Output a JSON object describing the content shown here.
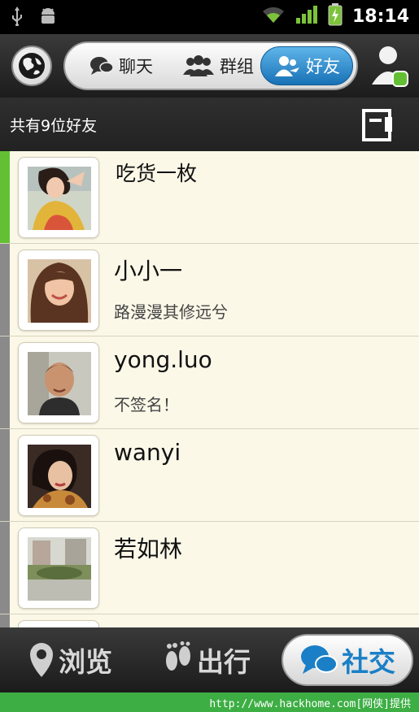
{
  "status_bar": {
    "time": "18:14",
    "icons": [
      "usb-icon",
      "android-debug-icon",
      "wifi-icon",
      "signal-icon",
      "battery-charging-icon"
    ]
  },
  "top_bar": {
    "tabs": [
      {
        "label": "聊天",
        "icon": "chat-icon",
        "selected": false
      },
      {
        "label": "群组",
        "icon": "group-icon",
        "selected": false
      },
      {
        "label": "好友",
        "icon": "friends-icon",
        "selected": true
      }
    ]
  },
  "friends": {
    "count_text": "共有9位好友",
    "items": [
      {
        "name": "吃货一枚",
        "signature": ""
      },
      {
        "name": "小小一",
        "signature": "路漫漫其修远兮"
      },
      {
        "name": "yong.luo",
        "signature": "不签名！"
      },
      {
        "name": "wanyi",
        "signature": ""
      },
      {
        "name": "若如林",
        "signature": ""
      },
      {
        "name": "",
        "signature": ""
      }
    ]
  },
  "bottom_nav": {
    "items": [
      {
        "label": "浏览",
        "icon": "location-pin-icon",
        "selected": false
      },
      {
        "label": "出行",
        "icon": "footprint-icon",
        "selected": false
      },
      {
        "label": "社交",
        "icon": "chat-bubbles-icon",
        "selected": true
      }
    ]
  },
  "footer": {
    "text": "http://www.hackhome.com[网侠]提供"
  },
  "colors": {
    "accent_green": "#63c034",
    "selected_blue": "#1771b5",
    "list_bg": "#fbf8e8"
  }
}
